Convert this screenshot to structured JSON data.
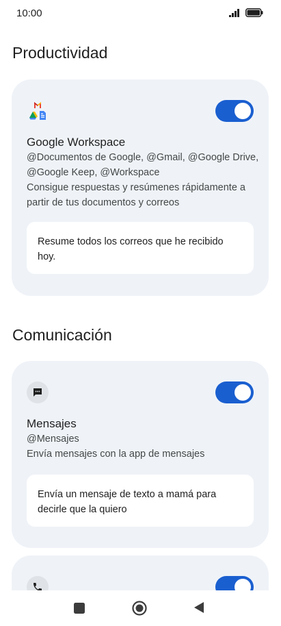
{
  "status_bar": {
    "time": "10:00"
  },
  "sections": {
    "productivity": {
      "title": "Productividad",
      "card": {
        "name": "Google Workspace",
        "description": "@Documentos de Google, @Gmail, @Google Drive, @Google Keep, @Workspace\nConsigue respuestas y resúmenes rápidamente a partir de tus documentos y correos",
        "description_line1": "@Documentos de Google, @Gmail, @Google Drive, @Google Keep, @Workspace",
        "description_line2": "Consigue respuestas y resúmenes rápidamente a partir de tus documentos y correos",
        "prompt": "Resume todos los correos que he recibido hoy.",
        "enabled": true
      }
    },
    "communication": {
      "title": "Comunicación",
      "cards": [
        {
          "name": "Mensajes",
          "handle": "@Mensajes",
          "description": "Envía mensajes con la app de mensajes",
          "prompt": "Envía un mensaje de texto a mamá para decirle que la quiero",
          "enabled": true
        },
        {
          "enabled": true
        }
      ]
    }
  },
  "icons": {
    "workspace": "google-workspace-icon",
    "messages": "message-bubble-icon",
    "phone": "phone-icon",
    "signal": "signal-icon",
    "battery": "battery-icon",
    "recents": "square-icon",
    "home": "home-circle-icon",
    "back": "back-triangle-icon"
  },
  "colors": {
    "accent": "#1a5fd0",
    "card_bg": "#eff3f8"
  }
}
